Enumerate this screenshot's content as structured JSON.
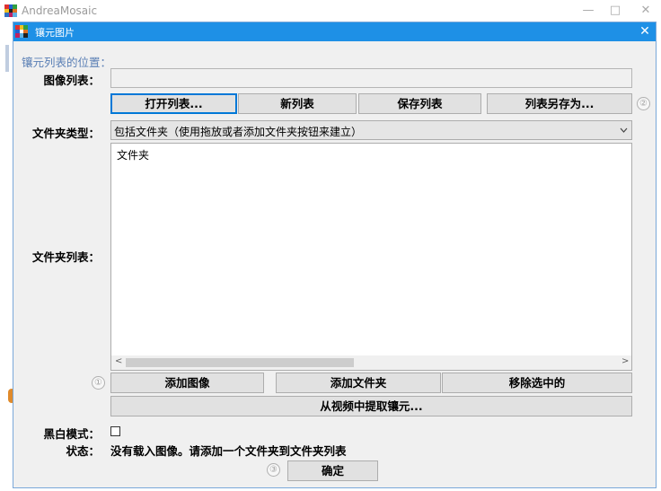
{
  "main_window": {
    "title": "AndreaMosaic",
    "controls": {
      "minimize": "—",
      "maximize": "□",
      "close": "✕"
    }
  },
  "dialog": {
    "title": "镶元图片",
    "close": "✕",
    "section_header": "镶元列表的位置：",
    "image_list": {
      "label": "图像列表：",
      "value": ""
    },
    "buttons_row1": {
      "open": "打开列表...",
      "new": "新列表",
      "save": "保存列表",
      "save_as": "列表另存为..."
    },
    "folder_type": {
      "label": "文件夹类型：",
      "selected": "包括文件夹（使用拖放或者添加文件夹按钮来建立）"
    },
    "folder_list": {
      "label": "文件夹列表：",
      "items": [
        "文件夹"
      ]
    },
    "buttons_row2": {
      "add_image": "添加图像",
      "add_folder": "添加文件夹",
      "remove": "移除选中的"
    },
    "extract_video": "从视频中提取镶元...",
    "bw_mode": {
      "label": "黑白模式：",
      "checked": false
    },
    "status": {
      "label": "状态：",
      "text": "没有载入图像。请添加一个文件夹到文件夹列表"
    },
    "ok": "确定",
    "help_marks": {
      "one": "①",
      "two": "②",
      "three": "③"
    }
  }
}
